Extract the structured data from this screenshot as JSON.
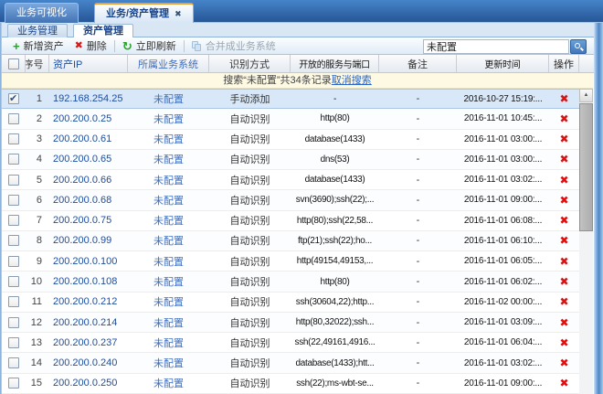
{
  "top_tabs": [
    {
      "label": "业务可视化",
      "active": false
    },
    {
      "label": "业务/资产管理",
      "active": true,
      "closable": true
    }
  ],
  "sub_tabs": [
    {
      "label": "业务管理",
      "active": false
    },
    {
      "label": "资产管理",
      "active": true
    }
  ],
  "toolbar": {
    "add_label": "新增资产",
    "delete_label": "删除",
    "refresh_label": "立即刷新",
    "merge_label": "合并成业务系统",
    "merge_disabled": true,
    "search_value": "未配置"
  },
  "table": {
    "headers": {
      "num": "序号",
      "ip": "资产IP",
      "system": "所属业务系统",
      "method": "识别方式",
      "services": "开放的服务与端口",
      "remark": "备注",
      "updated": "更新时间",
      "action": "操作"
    },
    "search_banner": {
      "text": "搜索“未配置”共34条记录",
      "cancel_link": "取消搜索"
    },
    "rows": [
      {
        "num": "1",
        "ip": "192.168.254.25",
        "system": "未配置",
        "method": "手动添加",
        "services": "-",
        "remark": "-",
        "updated": "2016-10-27 15:19:...",
        "checked": true,
        "selected": true
      },
      {
        "num": "2",
        "ip": "200.200.0.25",
        "system": "未配置",
        "method": "自动识别",
        "services": "http(80)",
        "remark": "-",
        "updated": "2016-11-01 10:45:...",
        "checked": false,
        "selected": false
      },
      {
        "num": "3",
        "ip": "200.200.0.61",
        "system": "未配置",
        "method": "自动识别",
        "services": "database(1433)",
        "remark": "-",
        "updated": "2016-11-01 03:00:...",
        "checked": false,
        "selected": false
      },
      {
        "num": "4",
        "ip": "200.200.0.65",
        "system": "未配置",
        "method": "自动识别",
        "services": "dns(53)",
        "remark": "-",
        "updated": "2016-11-01 03:00:...",
        "checked": false,
        "selected": false
      },
      {
        "num": "5",
        "ip": "200.200.0.66",
        "system": "未配置",
        "method": "自动识别",
        "services": "database(1433)",
        "remark": "-",
        "updated": "2016-11-01 03:02:...",
        "checked": false,
        "selected": false
      },
      {
        "num": "6",
        "ip": "200.200.0.68",
        "system": "未配置",
        "method": "自动识别",
        "services": "svn(3690);ssh(22);...",
        "remark": "-",
        "updated": "2016-11-01 09:00:...",
        "checked": false,
        "selected": false
      },
      {
        "num": "7",
        "ip": "200.200.0.75",
        "system": "未配置",
        "method": "自动识别",
        "services": "http(80);ssh(22,58...",
        "remark": "-",
        "updated": "2016-11-01 06:08:...",
        "checked": false,
        "selected": false
      },
      {
        "num": "8",
        "ip": "200.200.0.99",
        "system": "未配置",
        "method": "自动识别",
        "services": "ftp(21);ssh(22);ho...",
        "remark": "-",
        "updated": "2016-11-01 06:10:...",
        "checked": false,
        "selected": false
      },
      {
        "num": "9",
        "ip": "200.200.0.100",
        "system": "未配置",
        "method": "自动识别",
        "services": "http(49154,49153,...",
        "remark": "-",
        "updated": "2016-11-01 06:05:...",
        "checked": false,
        "selected": false
      },
      {
        "num": "10",
        "ip": "200.200.0.108",
        "system": "未配置",
        "method": "自动识别",
        "services": "http(80)",
        "remark": "-",
        "updated": "2016-11-01 06:02:...",
        "checked": false,
        "selected": false
      },
      {
        "num": "11",
        "ip": "200.200.0.212",
        "system": "未配置",
        "method": "自动识别",
        "services": "ssh(30604,22);http...",
        "remark": "-",
        "updated": "2016-11-02 00:00:...",
        "checked": false,
        "selected": false
      },
      {
        "num": "12",
        "ip": "200.200.0.214",
        "system": "未配置",
        "method": "自动识别",
        "services": "http(80,32022);ssh...",
        "remark": "-",
        "updated": "2016-11-01 03:09:...",
        "checked": false,
        "selected": false
      },
      {
        "num": "13",
        "ip": "200.200.0.237",
        "system": "未配置",
        "method": "自动识别",
        "services": "ssh(22,49161,4916...",
        "remark": "-",
        "updated": "2016-11-01 06:04:...",
        "checked": false,
        "selected": false
      },
      {
        "num": "14",
        "ip": "200.200.0.240",
        "system": "未配置",
        "method": "自动识别",
        "services": "database(1433);htt...",
        "remark": "-",
        "updated": "2016-11-01 03:02:...",
        "checked": false,
        "selected": false
      },
      {
        "num": "15",
        "ip": "200.200.0.250",
        "system": "未配置",
        "method": "自动识别",
        "services": "ssh(22);ms-wbt-se...",
        "remark": "-",
        "updated": "2016-11-01 09:00:...",
        "checked": false,
        "selected": false
      }
    ]
  },
  "colors": {
    "link_blue": "#3f6fbd",
    "ip_blue": "#1d4ea0",
    "delete_red": "#dd1111",
    "banner_bg": "#fdf9e3",
    "selection_bg": "#d9e8f8",
    "accent_orange": "#f0a030"
  }
}
